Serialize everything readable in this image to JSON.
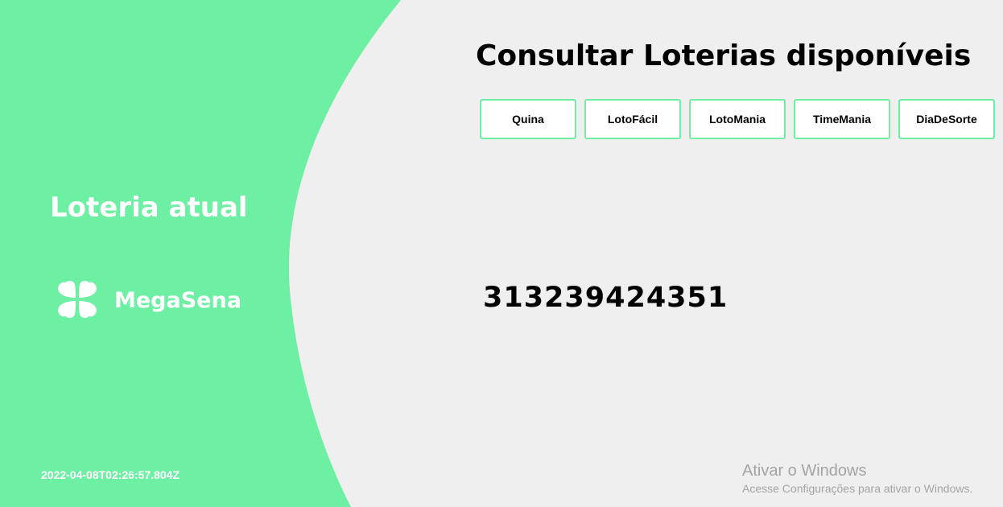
{
  "colors": {
    "accent": "#6df0a3",
    "background": "#efefef",
    "panel_text": "#ffffff",
    "watermark_text": "#a4a4a4"
  },
  "sidebar": {
    "title": "Loteria atual",
    "current_lottery": {
      "icon": "clover-icon",
      "name": "MegaSena"
    },
    "timestamp": "2022-04-08T02:26:57.804Z"
  },
  "main": {
    "title": "Consultar Loterias disponíveis",
    "lottery_buttons": [
      {
        "label": "Quina"
      },
      {
        "label": "LotoFácil"
      },
      {
        "label": "LotoMania"
      },
      {
        "label": "TimeMania"
      },
      {
        "label": "DiaDeSorte"
      }
    ],
    "result_numbers": "313239424351"
  },
  "windows_activation": {
    "title": "Ativar o Windows",
    "subtitle": "Acesse Configurações para ativar o Windows."
  }
}
